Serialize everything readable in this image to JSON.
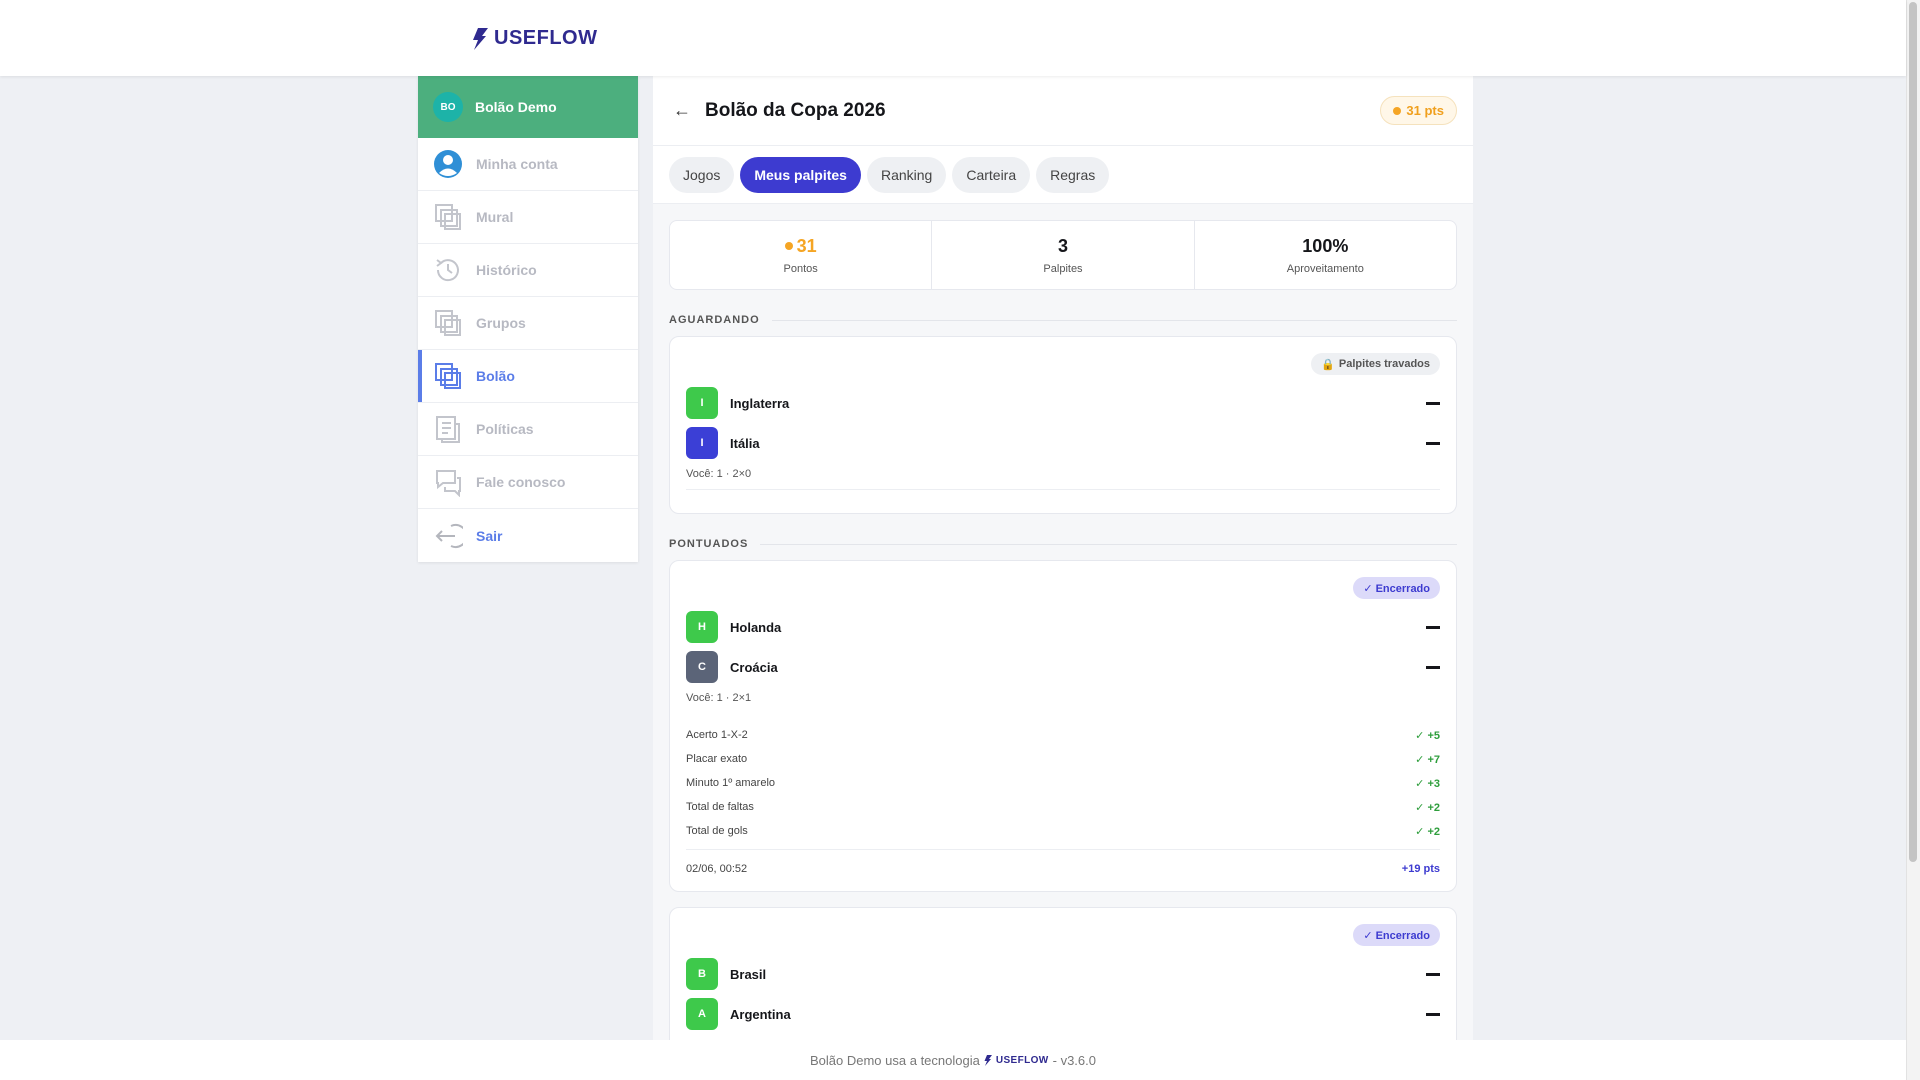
{
  "brand": {
    "name": "USEFLOW"
  },
  "sidebar": {
    "avatar_initials": "BO",
    "user_name": "Bolão Demo",
    "items": [
      {
        "label": "Minha conta",
        "icon": "user-circle-icon"
      },
      {
        "label": "Mural",
        "icon": "layers-icon"
      },
      {
        "label": "Histórico",
        "icon": "history-icon"
      },
      {
        "label": "Grupos",
        "icon": "layers-icon"
      },
      {
        "label": "Bolão",
        "icon": "layers-icon"
      },
      {
        "label": "Políticas",
        "icon": "document-icon"
      },
      {
        "label": "Fale conosco",
        "icon": "chat-icon"
      },
      {
        "label": "Sair",
        "icon": "logout-icon"
      }
    ],
    "active_index": 4
  },
  "header": {
    "title": "Bolão da Copa 2026",
    "points_badge": "31 pts"
  },
  "tabs": [
    "Jogos",
    "Meus palpites",
    "Ranking",
    "Carteira",
    "Regras"
  ],
  "active_tab": 1,
  "stats": [
    {
      "value": "31",
      "label": "Pontos"
    },
    {
      "value": "3",
      "label": "Palpites"
    },
    {
      "value": "100%",
      "label": "Aproveitamento"
    }
  ],
  "sections": {
    "waiting": "AGUARDANDO",
    "scored": "PONTUADOS"
  },
  "cards": [
    {
      "badge": "Palpites travados",
      "teams": [
        {
          "initial": "I",
          "name": "Inglaterra",
          "color": "#3ec94b"
        },
        {
          "initial": "I",
          "name": "Itália",
          "color": "#3b3fd6"
        }
      ],
      "guess": "Você: 1 · 2×0"
    },
    {
      "badge": "✓ Encerrado",
      "teams": [
        {
          "initial": "H",
          "name": "Holanda",
          "color": "#3ec94b"
        },
        {
          "initial": "C",
          "name": "Croácia",
          "color": "#5b6478"
        }
      ],
      "guess": "Você: 1 · 2×1",
      "scores": [
        {
          "label": "Acerto 1-X-2",
          "pts": "✓ +5"
        },
        {
          "label": "Placar exato",
          "pts": "✓ +7"
        },
        {
          "label": "Minuto 1º amarelo",
          "pts": "✓ +3"
        },
        {
          "label": "Total de faltas",
          "pts": "✓ +2"
        },
        {
          "label": "Total de gols",
          "pts": "✓ +2"
        }
      ],
      "datetime": "02/06, 00:52",
      "total": "+19 pts"
    },
    {
      "badge": "✓ Encerrado",
      "teams": [
        {
          "initial": "B",
          "name": "Brasil",
          "color": "#3ec94b"
        },
        {
          "initial": "A",
          "name": "Argentina",
          "color": "#3ec94b"
        }
      ]
    }
  ],
  "footer": {
    "prefix": "Bolão Demo usa a tecnologia",
    "brand": "USEFLOW",
    "version": "- v3.6.0"
  },
  "colors": {
    "accent": "#3d3bd0",
    "sidebar_header": "#4caf7e",
    "points": "#f5a524",
    "success": "#2e9e3c"
  }
}
